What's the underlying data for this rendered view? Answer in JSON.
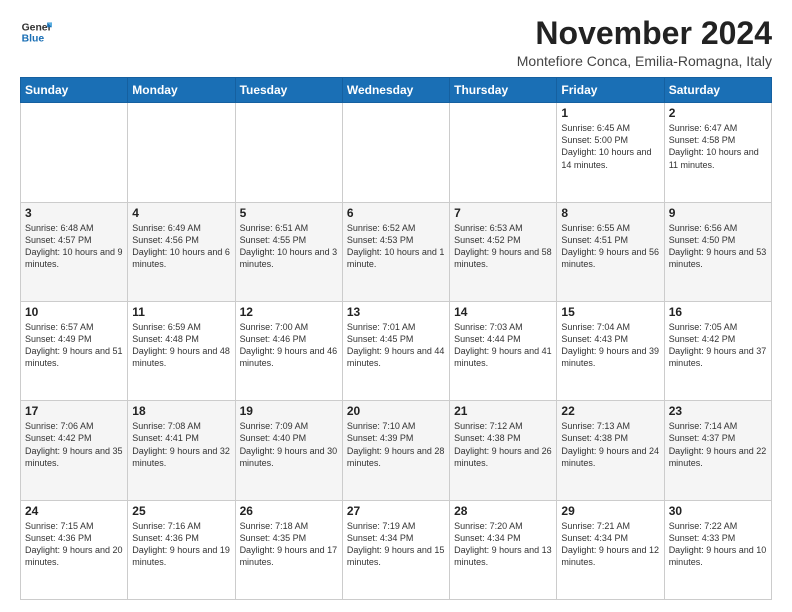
{
  "logo": {
    "line1": "General",
    "line2": "Blue"
  },
  "title": "November 2024",
  "location": "Montefiore Conca, Emilia-Romagna, Italy",
  "days_of_week": [
    "Sunday",
    "Monday",
    "Tuesday",
    "Wednesday",
    "Thursday",
    "Friday",
    "Saturday"
  ],
  "weeks": [
    [
      {
        "day": "",
        "info": ""
      },
      {
        "day": "",
        "info": ""
      },
      {
        "day": "",
        "info": ""
      },
      {
        "day": "",
        "info": ""
      },
      {
        "day": "",
        "info": ""
      },
      {
        "day": "1",
        "info": "Sunrise: 6:45 AM\nSunset: 5:00 PM\nDaylight: 10 hours and 14 minutes."
      },
      {
        "day": "2",
        "info": "Sunrise: 6:47 AM\nSunset: 4:58 PM\nDaylight: 10 hours and 11 minutes."
      }
    ],
    [
      {
        "day": "3",
        "info": "Sunrise: 6:48 AM\nSunset: 4:57 PM\nDaylight: 10 hours and 9 minutes."
      },
      {
        "day": "4",
        "info": "Sunrise: 6:49 AM\nSunset: 4:56 PM\nDaylight: 10 hours and 6 minutes."
      },
      {
        "day": "5",
        "info": "Sunrise: 6:51 AM\nSunset: 4:55 PM\nDaylight: 10 hours and 3 minutes."
      },
      {
        "day": "6",
        "info": "Sunrise: 6:52 AM\nSunset: 4:53 PM\nDaylight: 10 hours and 1 minute."
      },
      {
        "day": "7",
        "info": "Sunrise: 6:53 AM\nSunset: 4:52 PM\nDaylight: 9 hours and 58 minutes."
      },
      {
        "day": "8",
        "info": "Sunrise: 6:55 AM\nSunset: 4:51 PM\nDaylight: 9 hours and 56 minutes."
      },
      {
        "day": "9",
        "info": "Sunrise: 6:56 AM\nSunset: 4:50 PM\nDaylight: 9 hours and 53 minutes."
      }
    ],
    [
      {
        "day": "10",
        "info": "Sunrise: 6:57 AM\nSunset: 4:49 PM\nDaylight: 9 hours and 51 minutes."
      },
      {
        "day": "11",
        "info": "Sunrise: 6:59 AM\nSunset: 4:48 PM\nDaylight: 9 hours and 48 minutes."
      },
      {
        "day": "12",
        "info": "Sunrise: 7:00 AM\nSunset: 4:46 PM\nDaylight: 9 hours and 46 minutes."
      },
      {
        "day": "13",
        "info": "Sunrise: 7:01 AM\nSunset: 4:45 PM\nDaylight: 9 hours and 44 minutes."
      },
      {
        "day": "14",
        "info": "Sunrise: 7:03 AM\nSunset: 4:44 PM\nDaylight: 9 hours and 41 minutes."
      },
      {
        "day": "15",
        "info": "Sunrise: 7:04 AM\nSunset: 4:43 PM\nDaylight: 9 hours and 39 minutes."
      },
      {
        "day": "16",
        "info": "Sunrise: 7:05 AM\nSunset: 4:42 PM\nDaylight: 9 hours and 37 minutes."
      }
    ],
    [
      {
        "day": "17",
        "info": "Sunrise: 7:06 AM\nSunset: 4:42 PM\nDaylight: 9 hours and 35 minutes."
      },
      {
        "day": "18",
        "info": "Sunrise: 7:08 AM\nSunset: 4:41 PM\nDaylight: 9 hours and 32 minutes."
      },
      {
        "day": "19",
        "info": "Sunrise: 7:09 AM\nSunset: 4:40 PM\nDaylight: 9 hours and 30 minutes."
      },
      {
        "day": "20",
        "info": "Sunrise: 7:10 AM\nSunset: 4:39 PM\nDaylight: 9 hours and 28 minutes."
      },
      {
        "day": "21",
        "info": "Sunrise: 7:12 AM\nSunset: 4:38 PM\nDaylight: 9 hours and 26 minutes."
      },
      {
        "day": "22",
        "info": "Sunrise: 7:13 AM\nSunset: 4:38 PM\nDaylight: 9 hours and 24 minutes."
      },
      {
        "day": "23",
        "info": "Sunrise: 7:14 AM\nSunset: 4:37 PM\nDaylight: 9 hours and 22 minutes."
      }
    ],
    [
      {
        "day": "24",
        "info": "Sunrise: 7:15 AM\nSunset: 4:36 PM\nDaylight: 9 hours and 20 minutes."
      },
      {
        "day": "25",
        "info": "Sunrise: 7:16 AM\nSunset: 4:36 PM\nDaylight: 9 hours and 19 minutes."
      },
      {
        "day": "26",
        "info": "Sunrise: 7:18 AM\nSunset: 4:35 PM\nDaylight: 9 hours and 17 minutes."
      },
      {
        "day": "27",
        "info": "Sunrise: 7:19 AM\nSunset: 4:34 PM\nDaylight: 9 hours and 15 minutes."
      },
      {
        "day": "28",
        "info": "Sunrise: 7:20 AM\nSunset: 4:34 PM\nDaylight: 9 hours and 13 minutes."
      },
      {
        "day": "29",
        "info": "Sunrise: 7:21 AM\nSunset: 4:34 PM\nDaylight: 9 hours and 12 minutes."
      },
      {
        "day": "30",
        "info": "Sunrise: 7:22 AM\nSunset: 4:33 PM\nDaylight: 9 hours and 10 minutes."
      }
    ]
  ]
}
